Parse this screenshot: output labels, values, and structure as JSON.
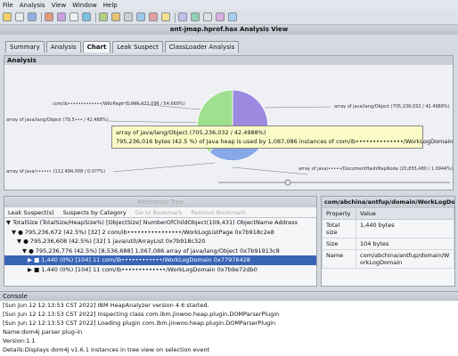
{
  "menu": {
    "items": [
      "File",
      "Analysis",
      "View",
      "Window",
      "Help"
    ]
  },
  "view": {
    "title": "ant-jmap.hprof.hax Analysis View",
    "tabs": [
      "Summary",
      "Analysis",
      "Chart",
      "Leak Suspect",
      "ClassLoader Analysis"
    ],
    "active_tab": "Chart"
  },
  "analysis": {
    "title": "Analysis",
    "labels": [
      "com/ib•••••••••••••/WikiPage (1,095,472,096 / 54.669%)",
      "array of java/lang/Object (79,5••• / 42.488%)",
      "array of java/lang/Object (705,236,032 / 42.4988%)",
      "array of java/•••••• (112,484,008 / 0.0??%)",
      "array of java/•••••/DocumentHashMapNode (20,855,480 / 1.0944%)"
    ],
    "tooltip": {
      "line1": "array of java/lang/Object (705,236,032 / 42.4988%)",
      "line2": "795,236,016 bytes (42.5 %) of Java heap is used by 1,087,086 instances of com/ib••••••••••••••/WorkLogDomain"
    }
  },
  "reference_tree": {
    "title": "Reference Tree",
    "toolbar": {
      "leak_suspects": "Leak Suspect(s)",
      "by_category": "Suspects by Category",
      "go_to_bookmark": "Go to Bookmark",
      "remove_bookmark": "Remove Bookmark"
    },
    "rows": [
      "▼ TotalSize (TotalSize/HeapSize%) [ObjectSize] NumberOfChildObject(109,431) ObjectName Address",
      "▼ ● 795,236,672 (42.5%) [32] 2 com/ib••••••••••••••••/WorkLogListPage 0x7b918c2e8",
      "▼ ● 795,236,608 (42.5%) [32] 1 java/util/ArrayList 0x7b918c320",
      "▼ ● 795,236,776 (42.5%) [8,536,688] 1,067,086 array of java/lang/Object 0x7b91913c8",
      "▶ ■ 1,440 (0%) [104] 11 com/ib••••••••••••/WorkLogDomain 0x77976428",
      "▶ ■ 1,440 (0%) [104] 11 com/ib•••••••••••••/WorkLogDomain 0x7b9e72db0"
    ],
    "selected_row": 4
  },
  "properties": {
    "title": "com/abchina/antfup/domain/WorkLogDomain",
    "headers": [
      "Property",
      "Value"
    ],
    "rows": [
      {
        "property": "Total size",
        "value": "1,440 bytes"
      },
      {
        "property": "Size",
        "value": "104 bytes"
      },
      {
        "property": "Name",
        "value": "com/abchina/antfup/domain/WorkLogDomain"
      }
    ]
  },
  "console": {
    "title": "Console",
    "lines": [
      "[Sun Jun 12 12:13:53 CST 2022] IBM HeapAnalyzer version 4.6 started.",
      "[Sun Jun 12 12:13:53 CST 2022] Inspecting class com.ibm.jinwoo.heap.plugin.DOMParserPlugin",
      "[Sun Jun 12 12:13:53 CST 2022] Loading plugin com.ibm.jinwoo.heap.plugin.DOMParserPlugin",
      "Name:dom4j parser plug-in",
      "Version:1.1",
      "Details:Displays dom4j v1.6.1 instances in tree view on selection event"
    ]
  },
  "colors": {
    "pie_purple": "#9b8ae0",
    "pie_green": "#9fe08f",
    "pie_blue": "#86a8e6",
    "selection": "#3965b7",
    "tooltip_bg": "#fbfbc8"
  }
}
